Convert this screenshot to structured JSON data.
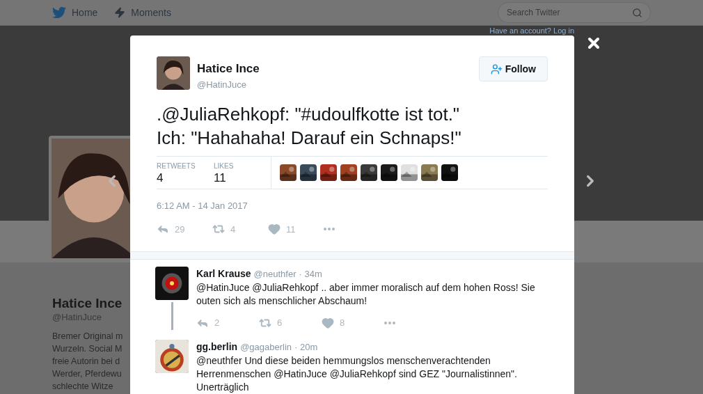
{
  "nav": {
    "items": [
      {
        "kind": "home",
        "label": "Home"
      },
      {
        "kind": "moments",
        "label": "Moments"
      }
    ],
    "search": {
      "placeholder": "Search Twitter"
    },
    "login_prompt": "Have an account? Log in"
  },
  "profile": {
    "name": "Hatice Ince",
    "handle": "@HatinJuce",
    "bio_lines": [
      "Bremer Original m",
      "Wurzeln. Social M",
      "freie Autorin bei d",
      "Werder, Pferdewu",
      "schlechte Witze"
    ]
  },
  "tweet": {
    "name": "Hatice Ince",
    "handle": "@HatinJuce",
    "follow_label": "Follow",
    "text_lines": [
      ".@JuliaRehkopf: \"#udoulfkotte ist tot.\"",
      "Ich: \"Hahahaha! Darauf ein Schnaps!\""
    ],
    "stats": [
      {
        "label": "RETWEETS",
        "value": "4"
      },
      {
        "label": "LIKES",
        "value": "11"
      }
    ],
    "likers": [
      {
        "color": "#8a4a2a"
      },
      {
        "color": "#3a4a5a"
      },
      {
        "color": "#b03020"
      },
      {
        "color": "#a04020"
      },
      {
        "color": "#3a3a3a"
      },
      {
        "color": "#1a1a1a"
      },
      {
        "color": "#e0e0e0"
      },
      {
        "color": "#8a7a50"
      },
      {
        "color": "#111111"
      }
    ],
    "timestamp": "6:12 AM - 14 Jan 2017",
    "actions": [
      {
        "kind": "reply",
        "count": "29"
      },
      {
        "kind": "retweet",
        "count": "4"
      },
      {
        "kind": "like",
        "count": "11"
      },
      {
        "kind": "more"
      }
    ]
  },
  "replies": [
    {
      "name": "Karl Krause",
      "handle": "@neuthfer",
      "time": "· 34m",
      "connected": true,
      "text": "@HatinJuce @JuliaRehkopf .. aber immer moralisch auf dem hohen Ross! Sie outen sich als menschlicher Abschaum!",
      "actions": [
        {
          "kind": "reply",
          "count": "2"
        },
        {
          "kind": "retweet",
          "count": "6"
        },
        {
          "kind": "like",
          "count": "8"
        },
        {
          "kind": "more"
        }
      ]
    },
    {
      "name": "gg.berlin",
      "handle": "@gagaberlin",
      "time": "· 20m",
      "connected": false,
      "text": "@neuthfer Und diese beiden hemmungslos menschenverachtenden Herrenmenschen @HatinJuce @JuliaRehkopf sind GEZ \"Journalistinnen\". Unerträglich"
    }
  ]
}
